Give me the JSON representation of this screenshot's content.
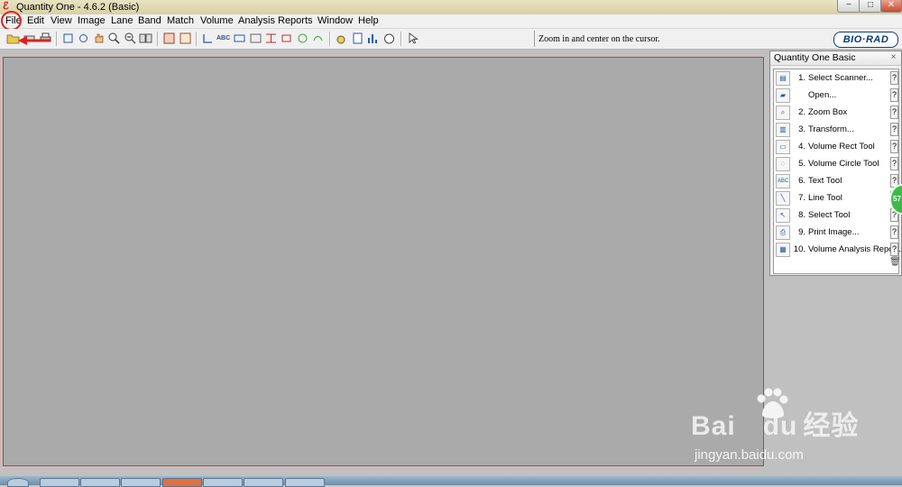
{
  "window": {
    "title": "Quantity One - 4.6.2 (Basic)",
    "minimize": "−",
    "maximize": "□",
    "close": "✕"
  },
  "menu": [
    "File",
    "Edit",
    "View",
    "Image",
    "Lane",
    "Band",
    "Match",
    "Volume",
    "Analysis",
    "Reports",
    "Window",
    "Help"
  ],
  "status": {
    "text": "Zoom in and center on the cursor."
  },
  "logo": {
    "text": "BIO·RAD"
  },
  "panel": {
    "title": "Quantity One Basic",
    "close": "×",
    "items": [
      {
        "num": "1.",
        "label": "Select Scanner...",
        "icon": "scanner-icon",
        "glyph": "▤",
        "help": "?"
      },
      {
        "num": "",
        "label": "Open...",
        "icon": "open-folder-icon",
        "glyph": "▰",
        "help": "?"
      },
      {
        "num": "2.",
        "label": "Zoom Box",
        "icon": "zoom-box-icon",
        "glyph": "⌕",
        "help": "?"
      },
      {
        "num": "3.",
        "label": "Transform...",
        "icon": "transform-icon",
        "glyph": "▥",
        "help": "?"
      },
      {
        "num": "4.",
        "label": "Volume Rect Tool",
        "icon": "volume-rect-icon",
        "glyph": "▭",
        "help": "?"
      },
      {
        "num": "5.",
        "label": "Volume Circle Tool",
        "icon": "volume-circle-icon",
        "glyph": "◌",
        "help": "?"
      },
      {
        "num": "6.",
        "label": "Text Tool",
        "icon": "text-tool-icon",
        "glyph": "ABC",
        "help": "?"
      },
      {
        "num": "7.",
        "label": "Line Tool",
        "icon": "line-tool-icon",
        "glyph": "╲",
        "help": "?"
      },
      {
        "num": "8.",
        "label": "Select Tool",
        "icon": "select-arrow-icon",
        "glyph": "↖",
        "help": "?"
      },
      {
        "num": "9.",
        "label": "Print Image...",
        "icon": "print-icon",
        "glyph": "⎙",
        "help": "?"
      },
      {
        "num": "10.",
        "label": "Volume Analysis Report...",
        "icon": "report-icon",
        "glyph": "▦",
        "help": "?"
      }
    ]
  },
  "overlay": {
    "bubble": "57"
  },
  "watermark": {
    "brand": "Bai",
    "brand2": "du",
    "cn": "经验",
    "url": "jingyan.baidu.com"
  },
  "colors": {
    "annotation": "#e02020",
    "workspace": "#aaaaaa",
    "brand": "#0a3a7a"
  }
}
